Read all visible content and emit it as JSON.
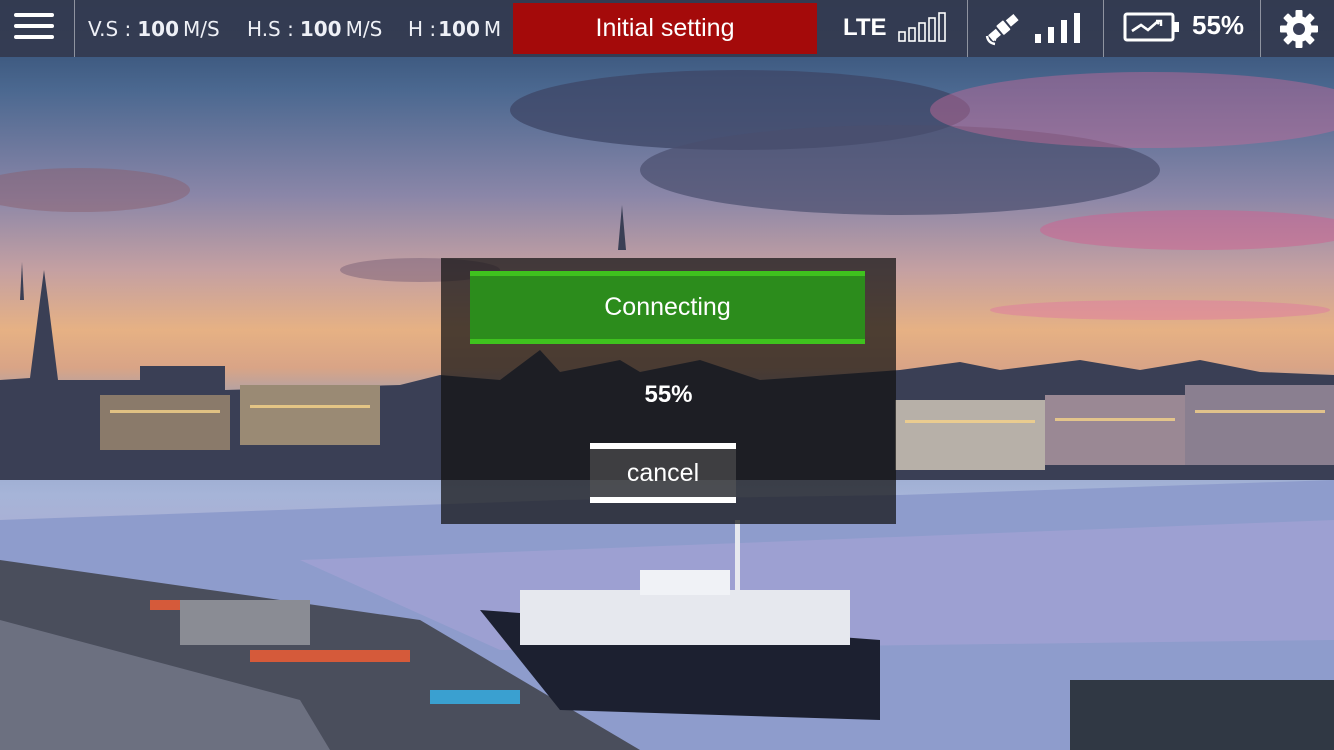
{
  "topbar": {
    "menu_icon": "hamburger-menu-icon",
    "vertical_speed": {
      "label": "V.S :",
      "value": "100",
      "unit": "M/S"
    },
    "horizontal_speed": {
      "label": "H.S :",
      "value": "100",
      "unit": "M/S"
    },
    "height": {
      "label": "H :",
      "value": "100",
      "unit": "M"
    },
    "mode_button": "Initial setting",
    "lte": {
      "label": "LTE",
      "icon": "lte-signal-icon",
      "bars_active": 0,
      "bars_total": 5
    },
    "gps": {
      "icon": "satellite-icon",
      "signal_icon": "signal-bars-icon",
      "bars_active": 4,
      "bars_total": 4
    },
    "battery": {
      "icon": "battery-charging-icon",
      "percent": "55%"
    },
    "settings_icon": "gear-icon"
  },
  "dialog": {
    "status": "Connecting",
    "progress": "55%",
    "cancel_label": "cancel"
  },
  "colors": {
    "topbar_bg": "#343a50",
    "mode_button_bg": "#a40a0a",
    "status_green": "#2c8c1c",
    "status_green_border": "#3fc21e"
  }
}
